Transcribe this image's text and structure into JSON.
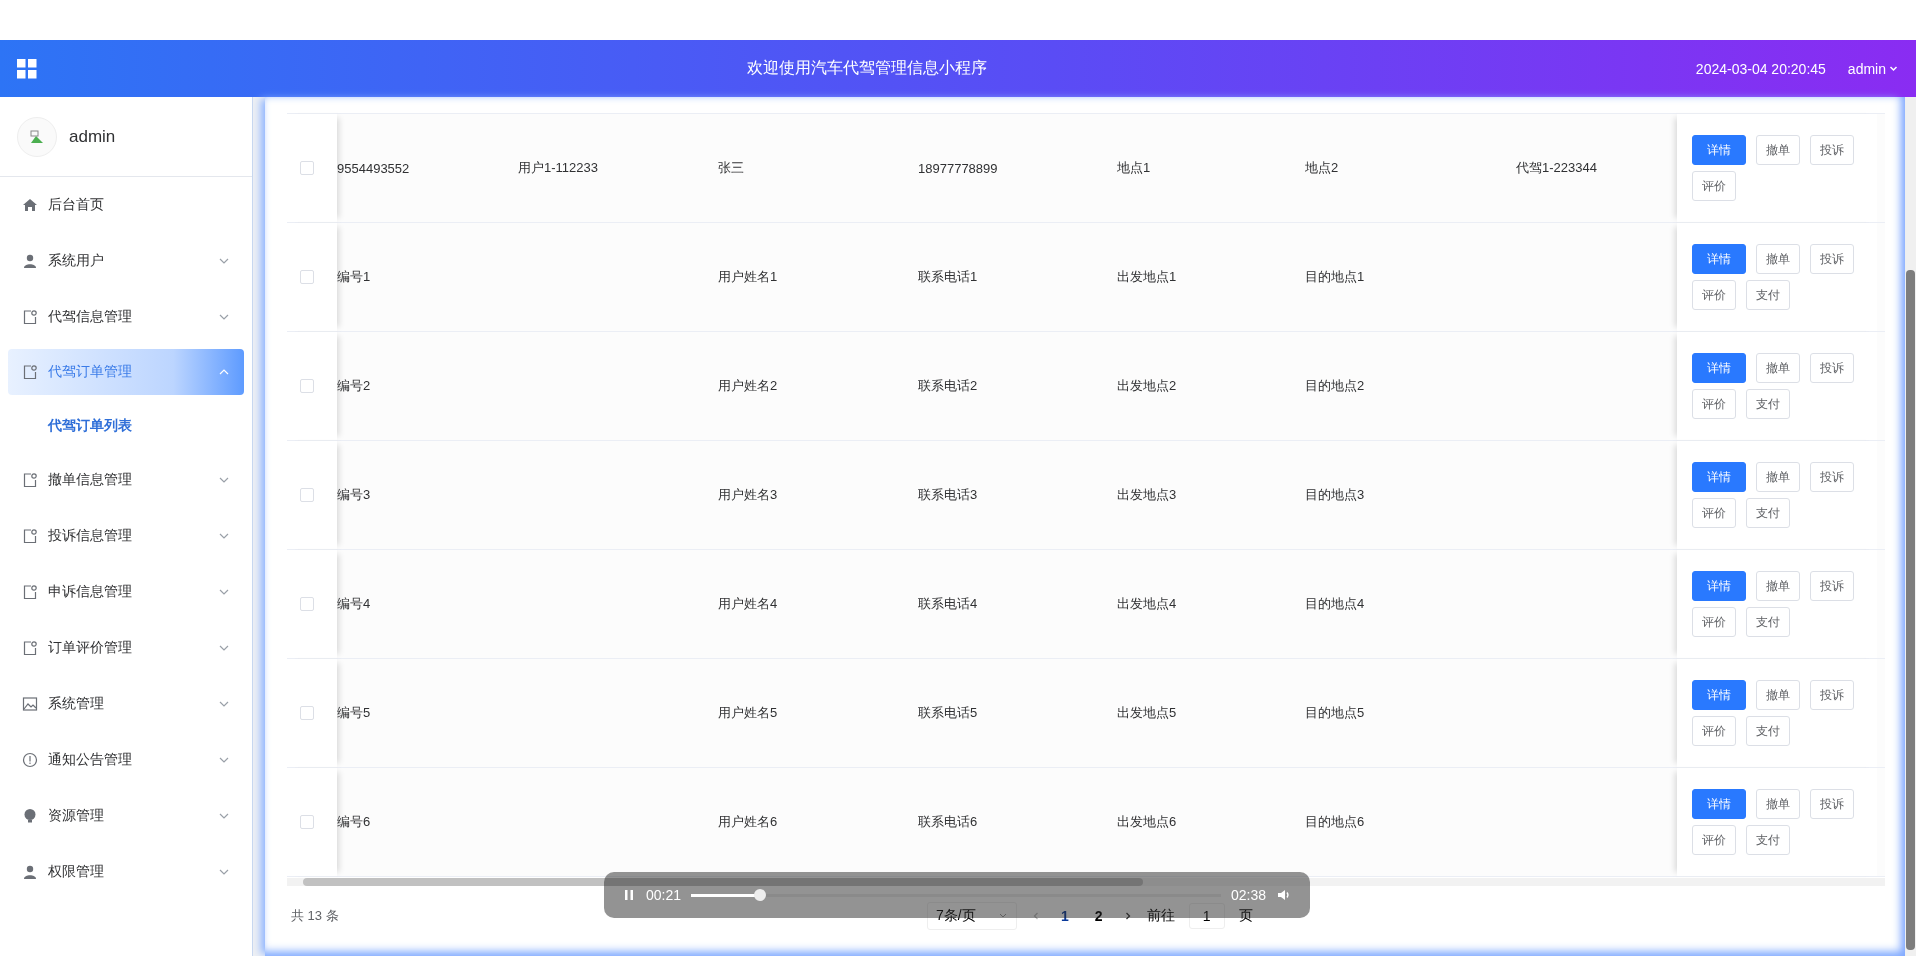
{
  "header": {
    "title": "欢迎使用汽车代驾管理信息小程序",
    "datetime": "2024-03-04 20:20:45",
    "user": "admin"
  },
  "sidebar": {
    "user": "admin",
    "items": [
      {
        "label": "后台首页",
        "kind": "link",
        "selected": false
      },
      {
        "label": "系统用户",
        "kind": "submenu",
        "selected": false,
        "expanded": false
      },
      {
        "label": "代驾信息管理",
        "kind": "submenu",
        "selected": false,
        "expanded": false
      },
      {
        "label": "代驾订单管理",
        "kind": "submenu",
        "selected": true,
        "expanded": true,
        "children": [
          {
            "label": "代驾订单列表",
            "selected": true
          }
        ]
      },
      {
        "label": "撤单信息管理",
        "kind": "submenu",
        "selected": false,
        "expanded": false
      },
      {
        "label": "投诉信息管理",
        "kind": "submenu",
        "selected": false,
        "expanded": false
      },
      {
        "label": "申诉信息管理",
        "kind": "submenu",
        "selected": false,
        "expanded": false
      },
      {
        "label": "订单评价管理",
        "kind": "submenu",
        "selected": false,
        "expanded": false
      },
      {
        "label": "系统管理",
        "kind": "submenu",
        "selected": false,
        "expanded": false
      },
      {
        "label": "通知公告管理",
        "kind": "submenu",
        "selected": false,
        "expanded": false
      },
      {
        "label": "资源管理",
        "kind": "submenu",
        "selected": false,
        "expanded": false
      },
      {
        "label": "权限管理",
        "kind": "submenu",
        "selected": false,
        "expanded": false
      }
    ]
  },
  "table": {
    "rows": [
      {
        "checked": false,
        "cells": [
          "9554493552",
          "用户1-112233",
          "张三",
          "18977778899",
          "地点1",
          "地点2",
          "代驾1-223344"
        ],
        "actions": [
          {
            "label": "详情",
            "kind": "primary"
          },
          {
            "label": "撤单",
            "kind": "plain"
          },
          {
            "label": "投诉",
            "kind": "plain"
          },
          {
            "label": "评价",
            "kind": "plain"
          }
        ]
      },
      {
        "checked": false,
        "cells": [
          "编号1",
          "",
          "用户姓名1",
          "联系电话1",
          "出发地点1",
          "目的地点1",
          ""
        ],
        "actions": [
          {
            "label": "详情",
            "kind": "primary"
          },
          {
            "label": "撤单",
            "kind": "plain"
          },
          {
            "label": "投诉",
            "kind": "plain"
          },
          {
            "label": "评价",
            "kind": "plain"
          },
          {
            "label": "支付",
            "kind": "plain"
          }
        ]
      },
      {
        "checked": false,
        "cells": [
          "编号2",
          "",
          "用户姓名2",
          "联系电话2",
          "出发地点2",
          "目的地点2",
          ""
        ],
        "actions": [
          {
            "label": "详情",
            "kind": "primary"
          },
          {
            "label": "撤单",
            "kind": "plain"
          },
          {
            "label": "投诉",
            "kind": "plain"
          },
          {
            "label": "评价",
            "kind": "plain"
          },
          {
            "label": "支付",
            "kind": "plain"
          }
        ]
      },
      {
        "checked": false,
        "cells": [
          "编号3",
          "",
          "用户姓名3",
          "联系电话3",
          "出发地点3",
          "目的地点3",
          ""
        ],
        "actions": [
          {
            "label": "详情",
            "kind": "primary"
          },
          {
            "label": "撤单",
            "kind": "plain"
          },
          {
            "label": "投诉",
            "kind": "plain"
          },
          {
            "label": "评价",
            "kind": "plain"
          },
          {
            "label": "支付",
            "kind": "plain"
          }
        ]
      },
      {
        "checked": false,
        "cells": [
          "编号4",
          "",
          "用户姓名4",
          "联系电话4",
          "出发地点4",
          "目的地点4",
          ""
        ],
        "actions": [
          {
            "label": "详情",
            "kind": "primary"
          },
          {
            "label": "撤单",
            "kind": "plain"
          },
          {
            "label": "投诉",
            "kind": "plain"
          },
          {
            "label": "评价",
            "kind": "plain"
          },
          {
            "label": "支付",
            "kind": "plain"
          }
        ]
      },
      {
        "checked": false,
        "cells": [
          "编号5",
          "",
          "用户姓名5",
          "联系电话5",
          "出发地点5",
          "目的地点5",
          ""
        ],
        "actions": [
          {
            "label": "详情",
            "kind": "primary"
          },
          {
            "label": "撤单",
            "kind": "plain"
          },
          {
            "label": "投诉",
            "kind": "plain"
          },
          {
            "label": "评价",
            "kind": "plain"
          },
          {
            "label": "支付",
            "kind": "plain"
          }
        ]
      },
      {
        "checked": false,
        "cells": [
          "编号6",
          "",
          "用户姓名6",
          "联系电话6",
          "出发地点6",
          "目的地点6",
          ""
        ],
        "actions": [
          {
            "label": "详情",
            "kind": "primary"
          },
          {
            "label": "撤单",
            "kind": "plain"
          },
          {
            "label": "投诉",
            "kind": "plain"
          },
          {
            "label": "评价",
            "kind": "plain"
          },
          {
            "label": "支付",
            "kind": "plain"
          }
        ]
      }
    ]
  },
  "pagination": {
    "total": "共 13 条",
    "page_size": "7条/页",
    "pages": [
      {
        "label": "1",
        "selected": true
      },
      {
        "label": "2",
        "selected": false
      }
    ],
    "goto_label": "前往",
    "goto_value": "1",
    "goto_suffix": "页"
  },
  "player": {
    "playing": true,
    "time": "00:21",
    "duration": "02:38",
    "level": 0.13
  }
}
